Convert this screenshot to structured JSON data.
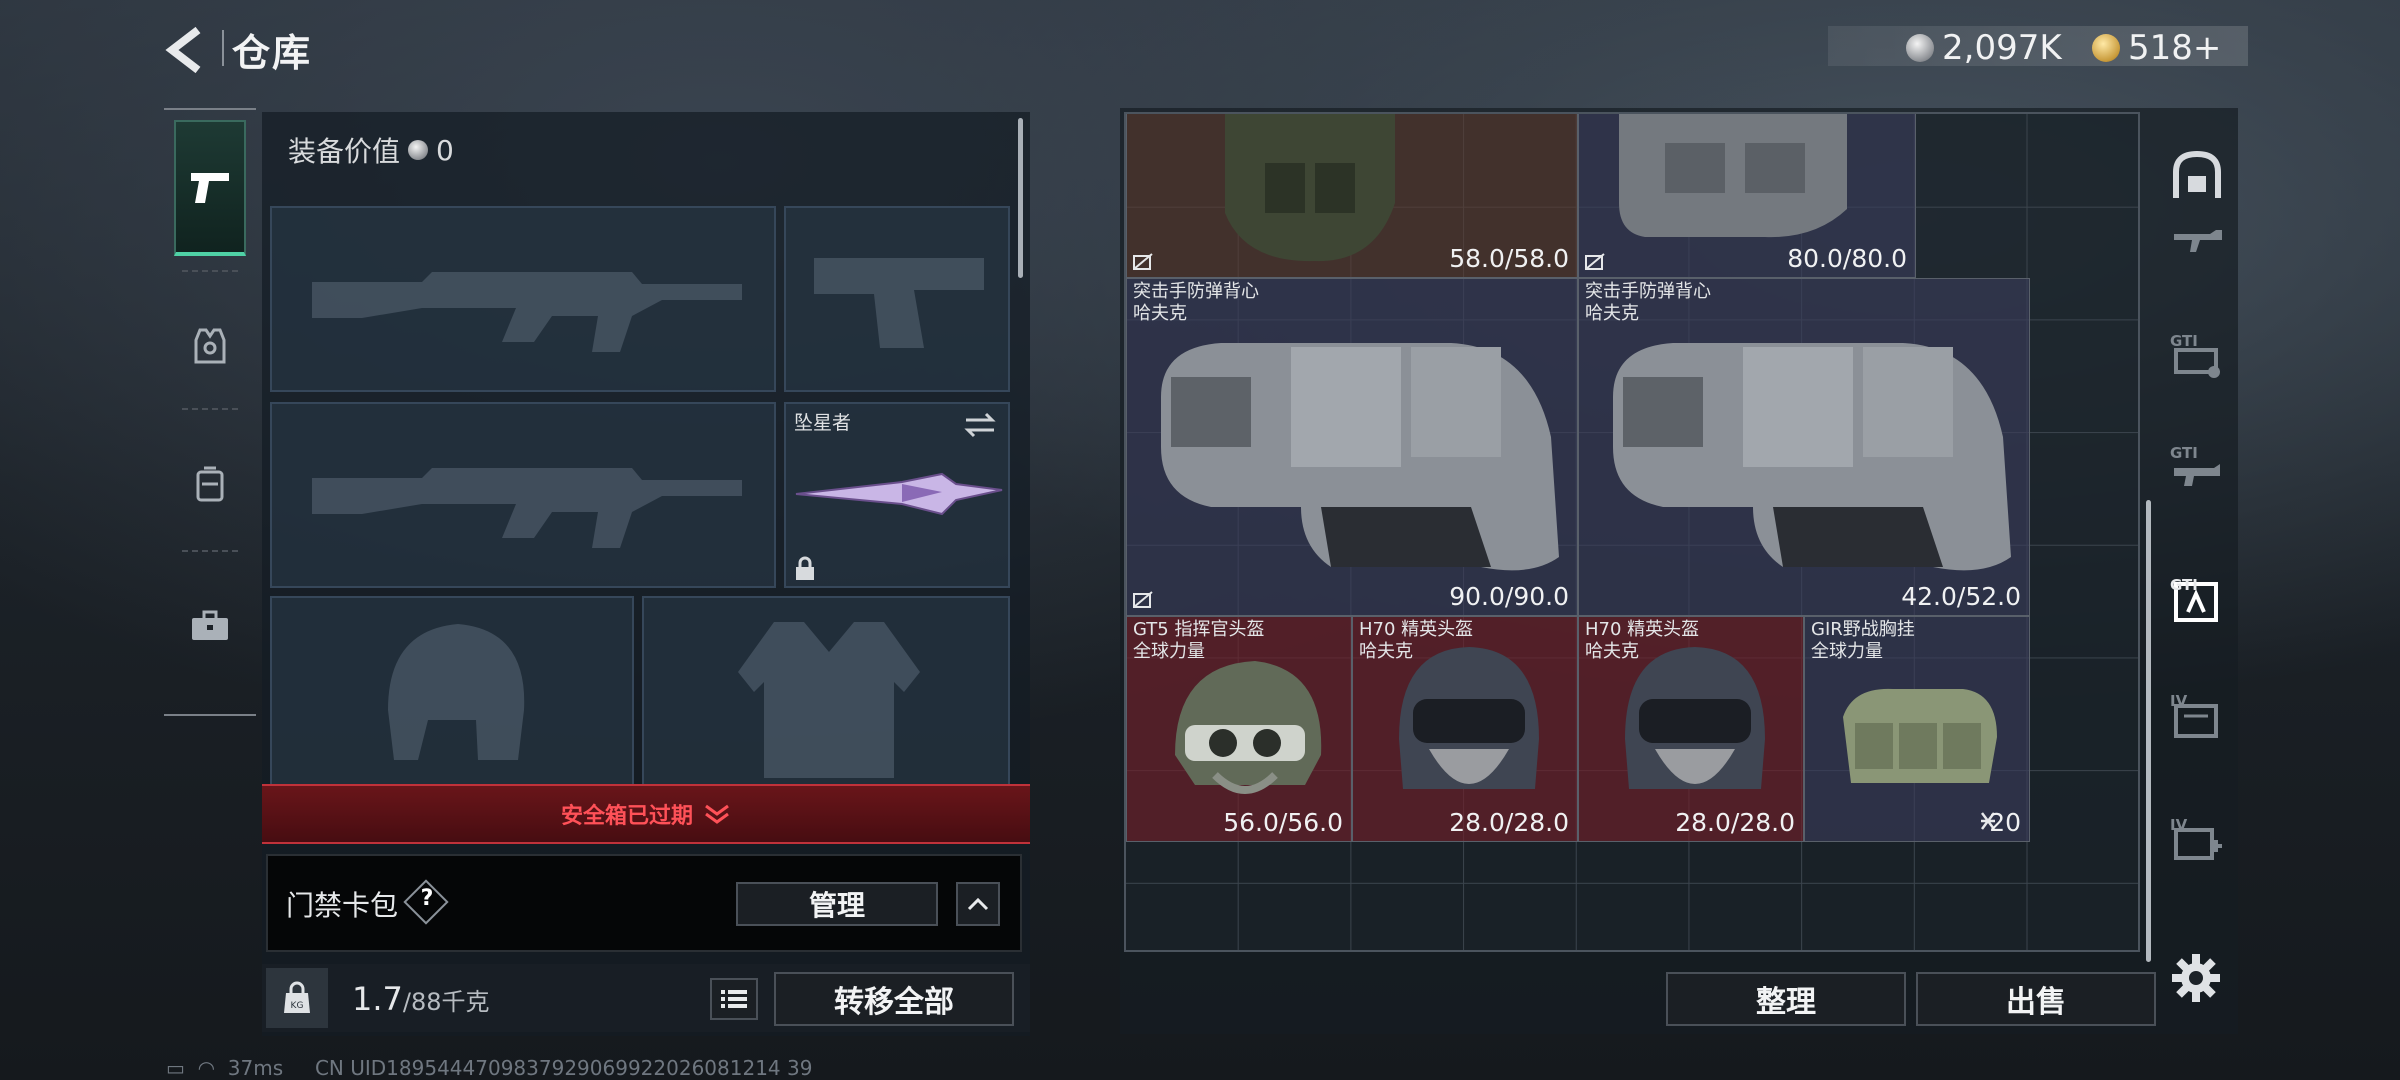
{
  "header": {
    "title": "仓库",
    "currency_silver": "2,097K",
    "currency_gold": "518+"
  },
  "loadout": {
    "equipment_value_label": "装备价值",
    "equipment_value": "0",
    "melee_name": "坠星者",
    "safe_box_status": "安全箱已过期",
    "card_pack_label": "门禁卡包",
    "help_mark": "?",
    "manage_label": "管理",
    "weight_current": "1.7",
    "weight_max": "/88千克",
    "transfer_all_label": "转移全部"
  },
  "stash": {
    "items": [
      {
        "name": "",
        "brand": "",
        "durability": "58.0/58.0",
        "rarity": "brown"
      },
      {
        "name": "",
        "brand": "",
        "durability": "80.0/80.0",
        "rarity": "purple"
      },
      {
        "name": "突击手防弹背心",
        "brand": "哈夫克",
        "durability": "90.0/90.0",
        "rarity": "purple"
      },
      {
        "name": "突击手防弹背心",
        "brand": "哈夫克",
        "durability": "42.0/52.0",
        "rarity": "purple"
      },
      {
        "name": "GT5 指挥官头盔",
        "brand": "全球力量",
        "durability": "56.0/56.0",
        "rarity": "red"
      },
      {
        "name": "H70 精英头盔",
        "brand": "哈夫克",
        "durability": "28.0/28.0",
        "rarity": "red"
      },
      {
        "name": "H70 精英头盔",
        "brand": "哈夫克",
        "durability": "28.0/28.0",
        "rarity": "red"
      },
      {
        "name": "GIR野战胸挂",
        "brand": "全球力量",
        "durability": "20",
        "rarity": "purple"
      }
    ],
    "sort_label": "整理",
    "sell_label": "出售"
  },
  "sidebar_right": {
    "labels": [
      "GTI",
      "GTI",
      "GTI",
      "IV",
      "IV"
    ]
  },
  "status_bar": {
    "ping": "37ms",
    "uid": "CN UID1895444709837929069922026081214 39"
  },
  "colors": {
    "accent_green": "#4fd1a5",
    "rarity_red": "#701e28",
    "rarity_purple": "#3a3c5c",
    "rarity_brown": "#603a2c",
    "warning_red": "#ff5158"
  }
}
